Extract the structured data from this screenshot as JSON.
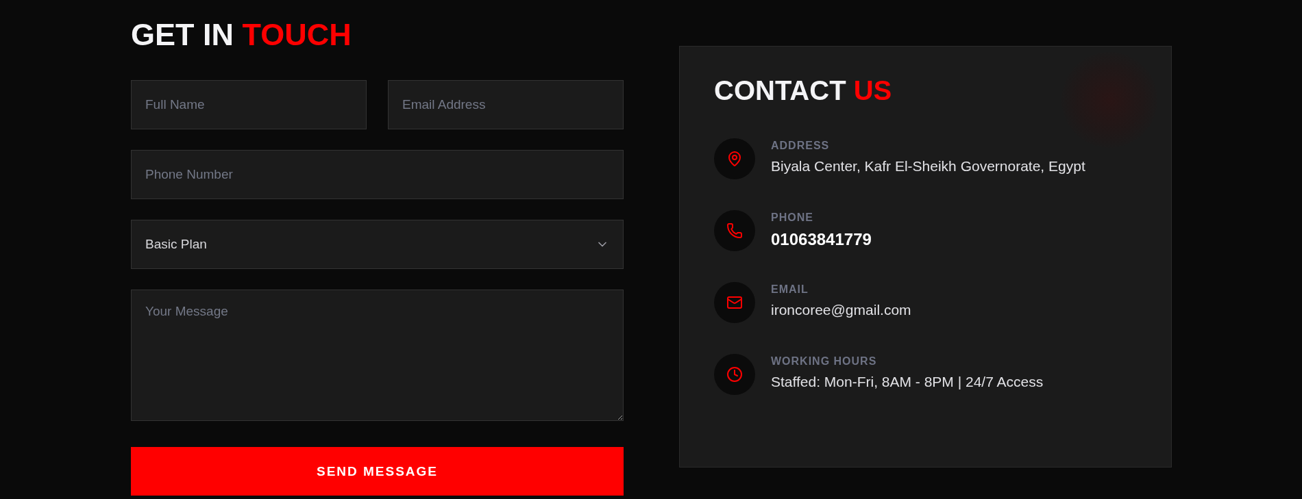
{
  "contact_form": {
    "heading": {
      "text": "GET IN",
      "accent": "TOUCH"
    },
    "fields": [
      {
        "kind": "input",
        "placeholder": "Full Name"
      },
      {
        "kind": "input",
        "placeholder": "Email Address"
      },
      {
        "kind": "input",
        "placeholder": "Phone Number"
      },
      {
        "kind": "select",
        "value": "Basic Plan"
      },
      {
        "kind": "textarea",
        "placeholder": "Your Message"
      }
    ],
    "submit_button": "SEND MESSAGE"
  },
  "contact_info": {
    "heading": {
      "text": "CONTACT",
      "accent": "US"
    },
    "items": [
      {
        "kind": "address",
        "label": "ADDRESS",
        "value": "Biyala Center, Kafr El-Sheikh Governorate, Egypt",
        "emphasis": false
      },
      {
        "kind": "phone",
        "label": "PHONE",
        "value": "01063841779",
        "emphasis": true
      },
      {
        "kind": "email",
        "label": "EMAIL",
        "value": "ironcoree@gmail.com",
        "emphasis": false
      },
      {
        "kind": "hours",
        "label": "WORKING HOURS",
        "value": "Staffed: Mon-Fri, 8AM - 8PM | 24/7 Access",
        "emphasis": false
      }
    ]
  }
}
